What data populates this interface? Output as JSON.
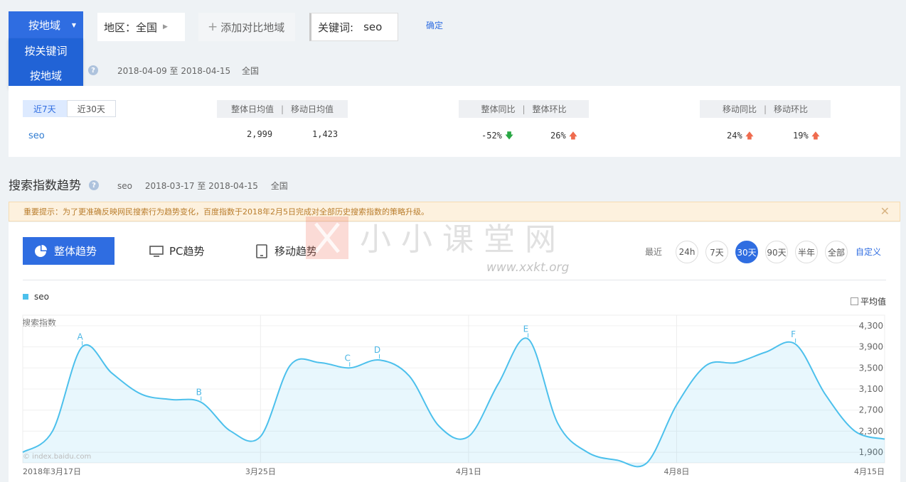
{
  "filters": {
    "mode_label": "按地域",
    "mode_menu": [
      "按关键词",
      "按地域"
    ],
    "region_label": "地区：全国",
    "add_label": "添加对比地域",
    "keyword_label": "关键词:",
    "keyword_value": "seo",
    "confirm_label": "确定"
  },
  "overview": {
    "date_range": "2018-04-09 至 2018-04-15",
    "region": "全国",
    "tabs": [
      "近7天",
      "近30天"
    ],
    "headers": {
      "avg": [
        "整体日均值",
        "移动日均值"
      ],
      "overall_compare": [
        "整体同比",
        "整体环比"
      ],
      "mobile_compare": [
        "移动同比",
        "移动环比"
      ]
    },
    "row": {
      "keyword": "seo",
      "overall_avg": "2,999",
      "mobile_avg": "1,423",
      "overall_yoy": "-52%",
      "overall_mom": "26%",
      "mobile_yoy": "24%",
      "mobile_mom": "19%"
    },
    "colors": {
      "up": "#ef6b4e",
      "down": "#29a744"
    }
  },
  "trend": {
    "title": "搜索指数趋势",
    "keyword": "seo",
    "date_range": "2018-03-17 至 2018-04-15",
    "region": "全国",
    "notice": "重要提示：为了更准确反映网民搜索行为趋势变化，百度指数于2018年2月5日完成对全部历史搜索指数的策略升级。",
    "tabs": [
      "整体趋势",
      "PC趋势",
      "移动趋势"
    ],
    "range_label": "最近",
    "ranges": [
      "24h",
      "7天",
      "30天",
      "90天",
      "半年",
      "全部"
    ],
    "active_range": "30天",
    "custom_label": "自定义",
    "legend": "seo",
    "avg_label": "平均值",
    "y_title": "搜索指数",
    "source": "© index.baidu.com"
  },
  "watermark": {
    "text": "小小课堂网",
    "url": "www.xxkt.org"
  },
  "chart_data": {
    "type": "area",
    "x_tick_labels": [
      "2018年3月17日",
      "3月25日",
      "4月1日",
      "4月8日",
      "4月15日"
    ],
    "y_ticks": [
      1900,
      2300,
      2700,
      3100,
      3500,
      3900,
      4300
    ],
    "y_tick_labels": [
      "1,900",
      "2,300",
      "2,700",
      "3,100",
      "3,500",
      "3,900",
      "4,300"
    ],
    "ylim": [
      1700,
      4500
    ],
    "series": [
      {
        "name": "seo",
        "color": "#4cc0ec",
        "values": [
          1900,
          2300,
          3900,
          3400,
          3000,
          2900,
          2850,
          2300,
          2200,
          3550,
          3600,
          3500,
          3650,
          3350,
          2400,
          2200,
          3200,
          4050,
          2450,
          1900,
          1750,
          1700,
          2800,
          3550,
          3600,
          3800,
          3950,
          3000,
          2300,
          2150
        ]
      }
    ],
    "annotations": [
      {
        "label": "A",
        "index": 2
      },
      {
        "label": "B",
        "index": 6
      },
      {
        "label": "C",
        "index": 11
      },
      {
        "label": "D",
        "index": 12
      },
      {
        "label": "E",
        "index": 17
      },
      {
        "label": "F",
        "index": 26
      }
    ],
    "grid": true,
    "legend_position": "top-left"
  }
}
